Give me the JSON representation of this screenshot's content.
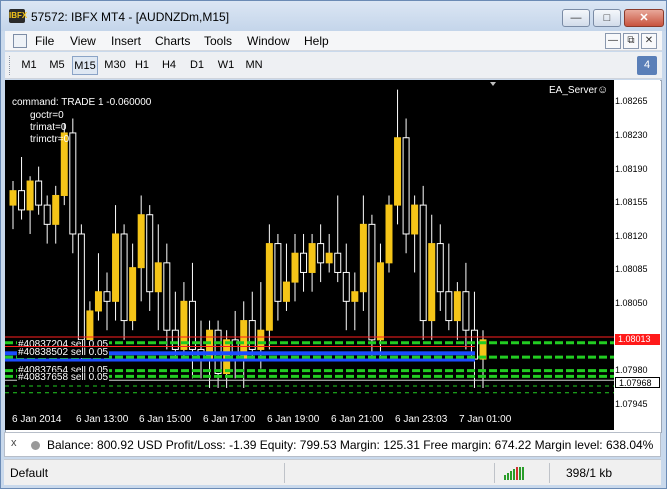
{
  "window": {
    "title": "57572: IBFX MT4 - [AUDNZDm,M15]",
    "app_icon_text": "IBFX"
  },
  "menu": {
    "items": [
      "File",
      "View",
      "Insert",
      "Charts",
      "Tools",
      "Window",
      "Help"
    ]
  },
  "toolbar": {
    "timeframes": [
      "M1",
      "M5",
      "M15",
      "M30",
      "H1",
      "H4",
      "D1",
      "W1",
      "MN"
    ],
    "active_timeframe": "M15",
    "notification_count": "4"
  },
  "chart": {
    "symbol_expert": "EA_Server",
    "comment_lines": [
      "command: TRADE 1 -0.060000",
      "goctr=0",
      "trimat=0",
      "trimctr=0"
    ],
    "orders": [
      {
        "label": "#40837204 sell 0.05",
        "color": "#ff2020"
      },
      {
        "label": "#40838502 sell 0.05",
        "color": "#2060ff"
      },
      {
        "label": "#40837654 sell 0.05",
        "color": "#20c020"
      },
      {
        "label": "#40837658 sell 0.05",
        "color": "#20c020"
      }
    ],
    "colors": {
      "background": "#000000",
      "bull_candle": "#f5c518",
      "bear_candle": "#000000",
      "candle_outline": "#ffffff",
      "order_red": "#ff2020",
      "order_blue": "#1a4cff",
      "order_green": "#22cc22"
    }
  },
  "chart_data": {
    "type": "candlestick",
    "symbol": "AUDNZDm",
    "timeframe": "M15",
    "y_ticks": [
      "1.08265",
      "1.08230",
      "1.08190",
      "1.08155",
      "1.08120",
      "1.08085",
      "1.08050",
      "1.08013",
      "1.07980",
      "1.07968",
      "1.07945"
    ],
    "ylim": [
      1.07935,
      1.0828
    ],
    "current_price": "1.08013",
    "ask_price": "1.07968",
    "x_ticks": [
      "6 Jan 2014",
      "6 Jan 13:00",
      "6 Jan 15:00",
      "6 Jan 17:00",
      "6 Jan 19:00",
      "6 Jan 21:00",
      "6 Jan 23:03",
      "7 Jan 01:00"
    ],
    "candles": [
      {
        "o": 1.0815,
        "h": 1.08175,
        "l": 1.08125,
        "c": 1.08165
      },
      {
        "o": 1.08165,
        "h": 1.082,
        "l": 1.08135,
        "c": 1.08145
      },
      {
        "o": 1.08145,
        "h": 1.0818,
        "l": 1.0812,
        "c": 1.08175
      },
      {
        "o": 1.08175,
        "h": 1.0819,
        "l": 1.0814,
        "c": 1.0815
      },
      {
        "o": 1.0815,
        "h": 1.0816,
        "l": 1.0811,
        "c": 1.0813
      },
      {
        "o": 1.0813,
        "h": 1.0817,
        "l": 1.0811,
        "c": 1.0816
      },
      {
        "o": 1.0816,
        "h": 1.08235,
        "l": 1.0815,
        "c": 1.08225
      },
      {
        "o": 1.08225,
        "h": 1.0824,
        "l": 1.081,
        "c": 1.0812
      },
      {
        "o": 1.0812,
        "h": 1.0813,
        "l": 1.0799,
        "c": 1.0801
      },
      {
        "o": 1.0801,
        "h": 1.0805,
        "l": 1.0799,
        "c": 1.0804
      },
      {
        "o": 1.0804,
        "h": 1.081,
        "l": 1.0803,
        "c": 1.0806
      },
      {
        "o": 1.0806,
        "h": 1.0808,
        "l": 1.0802,
        "c": 1.0805
      },
      {
        "o": 1.0805,
        "h": 1.0815,
        "l": 1.0803,
        "c": 1.0812
      },
      {
        "o": 1.0812,
        "h": 1.0813,
        "l": 1.0801,
        "c": 1.0803
      },
      {
        "o": 1.0803,
        "h": 1.0811,
        "l": 1.0802,
        "c": 1.08085
      },
      {
        "o": 1.08085,
        "h": 1.0816,
        "l": 1.0805,
        "c": 1.0814
      },
      {
        "o": 1.0814,
        "h": 1.0815,
        "l": 1.0804,
        "c": 1.0806
      },
      {
        "o": 1.0806,
        "h": 1.0813,
        "l": 1.0802,
        "c": 1.0809
      },
      {
        "o": 1.0809,
        "h": 1.0811,
        "l": 1.08,
        "c": 1.0802
      },
      {
        "o": 1.0802,
        "h": 1.0806,
        "l": 1.0799,
        "c": 1.08
      },
      {
        "o": 1.08,
        "h": 1.0807,
        "l": 1.0799,
        "c": 1.0805
      },
      {
        "o": 1.0805,
        "h": 1.0809,
        "l": 1.0797,
        "c": 1.08
      },
      {
        "o": 1.08,
        "h": 1.0803,
        "l": 1.0797,
        "c": 1.0799
      },
      {
        "o": 1.0799,
        "h": 1.0803,
        "l": 1.0796,
        "c": 1.0802
      },
      {
        "o": 1.0802,
        "h": 1.0803,
        "l": 1.0796,
        "c": 1.07975
      },
      {
        "o": 1.07975,
        "h": 1.0802,
        "l": 1.0796,
        "c": 1.0801
      },
      {
        "o": 1.0801,
        "h": 1.0804,
        "l": 1.0797,
        "c": 1.0799
      },
      {
        "o": 1.0799,
        "h": 1.0805,
        "l": 1.0796,
        "c": 1.0803
      },
      {
        "o": 1.0803,
        "h": 1.0806,
        "l": 1.0799,
        "c": 1.08
      },
      {
        "o": 1.08,
        "h": 1.0807,
        "l": 1.0798,
        "c": 1.0802
      },
      {
        "o": 1.0802,
        "h": 1.0813,
        "l": 1.08,
        "c": 1.0811
      },
      {
        "o": 1.0811,
        "h": 1.0812,
        "l": 1.0803,
        "c": 1.0805
      },
      {
        "o": 1.0805,
        "h": 1.0811,
        "l": 1.0804,
        "c": 1.0807
      },
      {
        "o": 1.0807,
        "h": 1.0812,
        "l": 1.0805,
        "c": 1.081
      },
      {
        "o": 1.081,
        "h": 1.0812,
        "l": 1.0806,
        "c": 1.0808
      },
      {
        "o": 1.0808,
        "h": 1.0812,
        "l": 1.0806,
        "c": 1.0811
      },
      {
        "o": 1.0811,
        "h": 1.0813,
        "l": 1.0807,
        "c": 1.0809
      },
      {
        "o": 1.0809,
        "h": 1.0812,
        "l": 1.0808,
        "c": 1.081
      },
      {
        "o": 1.081,
        "h": 1.0816,
        "l": 1.0807,
        "c": 1.0808
      },
      {
        "o": 1.0808,
        "h": 1.0811,
        "l": 1.0802,
        "c": 1.0805
      },
      {
        "o": 1.0805,
        "h": 1.0808,
        "l": 1.0802,
        "c": 1.0806
      },
      {
        "o": 1.0806,
        "h": 1.0816,
        "l": 1.0804,
        "c": 1.0813
      },
      {
        "o": 1.0813,
        "h": 1.0814,
        "l": 1.0799,
        "c": 1.0801
      },
      {
        "o": 1.0801,
        "h": 1.0811,
        "l": 1.0799,
        "c": 1.0809
      },
      {
        "o": 1.0809,
        "h": 1.0816,
        "l": 1.0808,
        "c": 1.0815
      },
      {
        "o": 1.0815,
        "h": 1.0827,
        "l": 1.0813,
        "c": 1.0822
      },
      {
        "o": 1.0822,
        "h": 1.0824,
        "l": 1.081,
        "c": 1.0812
      },
      {
        "o": 1.0812,
        "h": 1.0816,
        "l": 1.0808,
        "c": 1.0815
      },
      {
        "o": 1.0815,
        "h": 1.0817,
        "l": 1.0801,
        "c": 1.0803
      },
      {
        "o": 1.0803,
        "h": 1.0814,
        "l": 1.0801,
        "c": 1.0811
      },
      {
        "o": 1.0811,
        "h": 1.0813,
        "l": 1.0804,
        "c": 1.0806
      },
      {
        "o": 1.0806,
        "h": 1.0811,
        "l": 1.0802,
        "c": 1.0803
      },
      {
        "o": 1.0803,
        "h": 1.0807,
        "l": 1.0801,
        "c": 1.0806
      },
      {
        "o": 1.0806,
        "h": 1.0809,
        "l": 1.08,
        "c": 1.0802
      },
      {
        "o": 1.0802,
        "h": 1.0806,
        "l": 1.0796,
        "c": 1.0799
      },
      {
        "o": 1.0799,
        "h": 1.0802,
        "l": 1.0796,
        "c": 1.0801
      }
    ]
  },
  "account": {
    "close_glyph": "x",
    "summary": "Balance: 800.92 USD  Profit/Loss: -1.39  Equity: 799.53  Margin: 125.31  Free margin: 674.22  Margin level: 638.04%"
  },
  "statusbar": {
    "profile": "Default",
    "traffic": "398/1 kb"
  }
}
